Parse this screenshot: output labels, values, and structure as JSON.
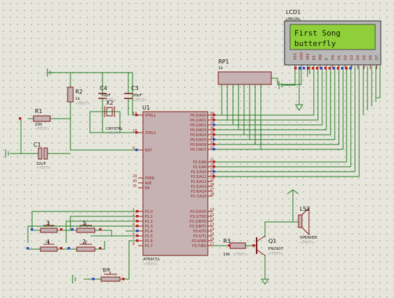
{
  "lcd": {
    "ref": "LCD1",
    "part": "LM016L",
    "line1": "First Song",
    "line2": "butterfly",
    "pins": [
      "VSS",
      "VDD",
      "VEE",
      "RS",
      "RW",
      "E",
      "D0",
      "D1",
      "D2",
      "D3",
      "D4",
      "D5",
      "D6",
      "D7"
    ]
  },
  "rp1": {
    "ref": "RP1",
    "value": "1k"
  },
  "u1": {
    "ref": "U1",
    "part": "AT89C51",
    "text": "<TEXT>",
    "left_pins": [
      {
        "num": "19",
        "name": "XTAL1"
      },
      {
        "num": "18",
        "name": "XTAL2"
      },
      {
        "num": "9",
        "name": "RST"
      },
      {
        "num": "29",
        "name": "PSEN"
      },
      {
        "num": "30",
        "name": "ALE"
      },
      {
        "num": "31",
        "name": "EA"
      },
      {
        "num": "1",
        "name": "P1.0"
      },
      {
        "num": "2",
        "name": "P1.1"
      },
      {
        "num": "3",
        "name": "P1.2"
      },
      {
        "num": "4",
        "name": "P1.3"
      },
      {
        "num": "5",
        "name": "P1.4"
      },
      {
        "num": "6",
        "name": "P1.5"
      },
      {
        "num": "7",
        "name": "P1.6"
      },
      {
        "num": "8",
        "name": "P1.7"
      }
    ],
    "right_pins": [
      {
        "num": "39",
        "name": "P0.0/AD0"
      },
      {
        "num": "38",
        "name": "P0.1/AD1"
      },
      {
        "num": "37",
        "name": "P0.2/AD2"
      },
      {
        "num": "36",
        "name": "P0.3/AD3"
      },
      {
        "num": "35",
        "name": "P0.4/AD4"
      },
      {
        "num": "34",
        "name": "P0.5/AD5"
      },
      {
        "num": "33",
        "name": "P0.6/AD6"
      },
      {
        "num": "32",
        "name": "P0.7/AD7"
      },
      {
        "num": "21",
        "name": "P2.0/A8"
      },
      {
        "num": "22",
        "name": "P2.1/A9"
      },
      {
        "num": "23",
        "name": "P2.2/A10"
      },
      {
        "num": "24",
        "name": "P2.3/A11"
      },
      {
        "num": "25",
        "name": "P2.4/A12"
      },
      {
        "num": "26",
        "name": "P2.5/A13"
      },
      {
        "num": "27",
        "name": "P2.6/A14"
      },
      {
        "num": "28",
        "name": "P2.7/A15"
      },
      {
        "num": "10",
        "name": "P3.0/RXD"
      },
      {
        "num": "11",
        "name": "P3.1/TXD"
      },
      {
        "num": "12",
        "name": "P3.2/INT0"
      },
      {
        "num": "13",
        "name": "P3.3/INT1"
      },
      {
        "num": "14",
        "name": "P3.4/T0"
      },
      {
        "num": "15",
        "name": "P3.5/T1"
      },
      {
        "num": "16",
        "name": "P3.6/WR"
      },
      {
        "num": "17",
        "name": "P3.7/RD"
      }
    ]
  },
  "r1": {
    "ref": "R1",
    "value": "200",
    "text": "<TEXT>"
  },
  "r2": {
    "ref": "R2",
    "value": "1k",
    "text": "<TEXT>"
  },
  "r3": {
    "ref": "R3",
    "value": "10k",
    "text": "<TEXT>"
  },
  "c1": {
    "ref": "C1",
    "value": "22uF",
    "text": "<TEXT>"
  },
  "c3": {
    "ref": "C3",
    "value": "30pF",
    "text": "<TEXT>"
  },
  "c4": {
    "ref": "C4",
    "value": "30pF",
    "text": "<TEXT>"
  },
  "x2": {
    "ref": "X2",
    "value": "CRYSTAL",
    "text": "<TEXT>"
  },
  "q1": {
    "ref": "Q1",
    "part": "PN2907",
    "text": "<TEXT>"
  },
  "ls2": {
    "ref": "LS2",
    "part": "SPEAKER",
    "text": "<TEXT>"
  },
  "buttons": {
    "b1": "1",
    "b2": "2",
    "b3": "3",
    "b4": "4",
    "extra": "暂停"
  }
}
